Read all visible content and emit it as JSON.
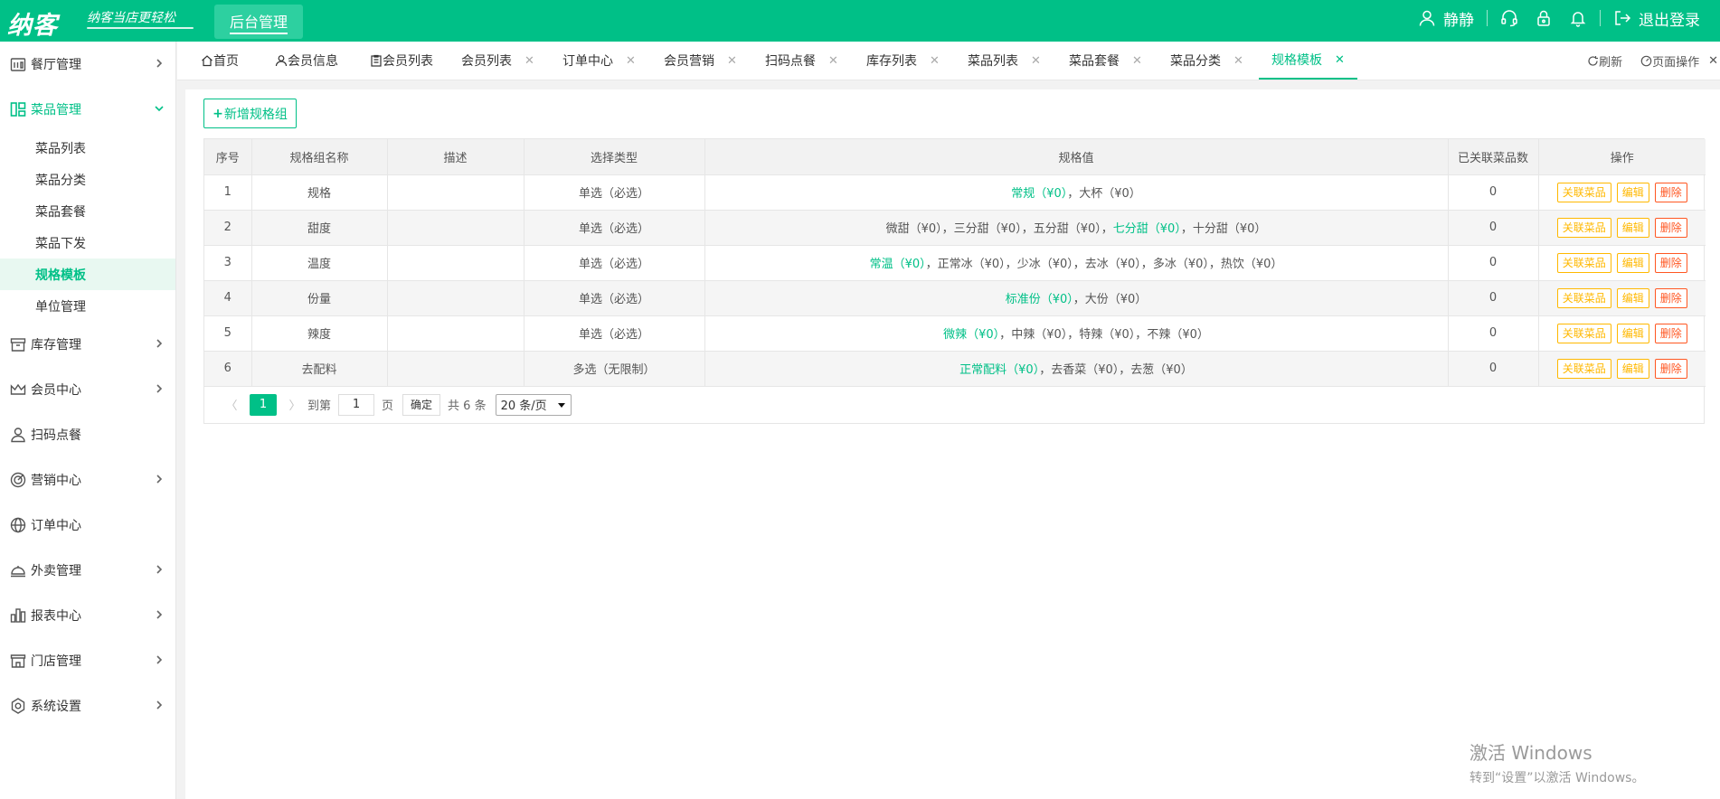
{
  "brand": {
    "logo": "纳客",
    "slogan": "纳客当店更轻松",
    "module": "后台管理"
  },
  "user": {
    "name": "静静",
    "logout": "退出登录"
  },
  "sidebar": {
    "items": [
      {
        "label": "餐厅管理",
        "icon": "restaurant-icon"
      },
      {
        "label": "菜品管理",
        "icon": "dishes-icon",
        "expanded": true,
        "children": [
          "菜品列表",
          "菜品分类",
          "菜品套餐",
          "菜品下发",
          "规格模板",
          "单位管理"
        ],
        "active_child": "规格模板"
      },
      {
        "label": "库存管理",
        "icon": "inventory-icon"
      },
      {
        "label": "会员中心",
        "icon": "crown-icon"
      },
      {
        "label": "扫码点餐",
        "icon": "person-icon"
      },
      {
        "label": "营销中心",
        "icon": "target-icon"
      },
      {
        "label": "订单中心",
        "icon": "globe-icon"
      },
      {
        "label": "外卖管理",
        "icon": "delivery-icon"
      },
      {
        "label": "报表中心",
        "icon": "report-icon"
      },
      {
        "label": "门店管理",
        "icon": "store-icon"
      },
      {
        "label": "系统设置",
        "icon": "settings-icon"
      }
    ]
  },
  "tabs": [
    {
      "label": "首页",
      "icon": "home-icon",
      "closable": false
    },
    {
      "label": "会员信息",
      "icon": "user-icon",
      "closable": false
    },
    {
      "label": "会员列表",
      "icon": "clipboard-icon",
      "closable": false
    },
    {
      "label": "会员列表",
      "closable": true
    },
    {
      "label": "订单中心",
      "closable": true
    },
    {
      "label": "会员营销",
      "closable": true
    },
    {
      "label": "扫码点餐",
      "closable": true
    },
    {
      "label": "库存列表",
      "closable": true
    },
    {
      "label": "菜品列表",
      "closable": true
    },
    {
      "label": "菜品套餐",
      "closable": true
    },
    {
      "label": "菜品分类",
      "closable": true
    },
    {
      "label": "规格模板",
      "closable": true,
      "active": true
    }
  ],
  "tools": {
    "refresh": "刷新",
    "page_ops": "页面操作"
  },
  "actions": {
    "add_group": "新增规格组"
  },
  "table": {
    "headers": [
      "序号",
      "规格组名称",
      "描述",
      "选择类型",
      "规格值",
      "已关联菜品数",
      "操作"
    ],
    "rows": [
      {
        "no": "1",
        "name": "规格",
        "desc": "",
        "type": "单选（必选）",
        "values": [
          {
            "text": "常规（¥0）",
            "default": true
          },
          {
            "text": "大杯（¥0）",
            "default": false
          }
        ],
        "count": "0"
      },
      {
        "no": "2",
        "name": "甜度",
        "desc": "",
        "type": "单选（必选）",
        "values": [
          {
            "text": "微甜（¥0）",
            "default": false
          },
          {
            "text": "三分甜（¥0）",
            "default": false
          },
          {
            "text": "五分甜（¥0）",
            "default": false
          },
          {
            "text": "七分甜（¥0）",
            "default": true
          },
          {
            "text": "十分甜（¥0）",
            "default": false
          }
        ],
        "count": "0"
      },
      {
        "no": "3",
        "name": "温度",
        "desc": "",
        "type": "单选（必选）",
        "values": [
          {
            "text": "常温（¥0）",
            "default": true
          },
          {
            "text": "正常冰（¥0）",
            "default": false
          },
          {
            "text": "少冰（¥0）",
            "default": false
          },
          {
            "text": "去冰（¥0）",
            "default": false
          },
          {
            "text": "多冰（¥0）",
            "default": false
          },
          {
            "text": "热饮（¥0）",
            "default": false
          }
        ],
        "count": "0"
      },
      {
        "no": "4",
        "name": "份量",
        "desc": "",
        "type": "单选（必选）",
        "values": [
          {
            "text": "标准份（¥0）",
            "default": true
          },
          {
            "text": "大份（¥0）",
            "default": false
          }
        ],
        "count": "0"
      },
      {
        "no": "5",
        "name": "辣度",
        "desc": "",
        "type": "单选（必选）",
        "values": [
          {
            "text": "微辣（¥0）",
            "default": true
          },
          {
            "text": "中辣（¥0）",
            "default": false
          },
          {
            "text": "特辣（¥0）",
            "default": false
          },
          {
            "text": "不辣（¥0）",
            "default": false
          }
        ],
        "count": "0"
      },
      {
        "no": "6",
        "name": "去配料",
        "desc": "",
        "type": "多选（无限制）",
        "values": [
          {
            "text": "正常配料（¥0）",
            "default": true
          },
          {
            "text": "去香菜（¥0）",
            "default": false
          },
          {
            "text": "去葱（¥0）",
            "default": false
          }
        ],
        "count": "0"
      }
    ],
    "row_actions": {
      "link": "关联菜品",
      "edit": "编辑",
      "delete": "删除"
    }
  },
  "pagination": {
    "current": "1",
    "goto_label": "到第",
    "goto_value": "1",
    "page_unit": "页",
    "confirm": "确定",
    "total": "共 6 条",
    "page_size": "20 条/页"
  },
  "watermark": {
    "line1": "激活 Windows",
    "line2": "转到“设置”以激活 Windows。"
  },
  "colors": {
    "primary": "#00c087",
    "warning": "#ffb800",
    "danger": "#ff5722"
  }
}
